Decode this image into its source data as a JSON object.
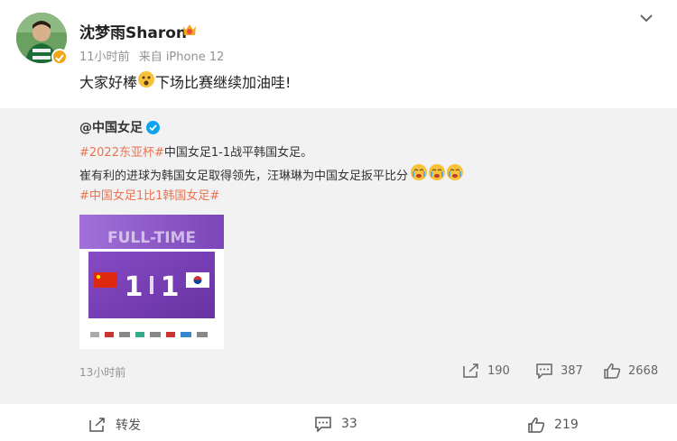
{
  "header": {
    "username": "沈梦雨Sharon",
    "time": "11小时前",
    "source": "来自 iPhone 12",
    "post_text_1": "大家好棒",
    "post_text_2": "下场比赛继续加油哇!",
    "avatar_icon": "avatar-photo",
    "badge_icon": "verified-gold-badge",
    "crown_icon": "crying-face-emoji"
  },
  "repost": {
    "author": "@中国女足",
    "tag1": "#2022东亚杯#",
    "line1_text": "中国女足1-1战平韩国女足。",
    "line2_text": "崔有利的进球为韩国女足取得领先，汪琳琳为中国女足扳平比分",
    "tag2": "#中国女足1比1韩国女足#",
    "image": {
      "banner": "FULL-TIME",
      "score_left": "1",
      "score_right": "1",
      "left_flag": "china-flag",
      "right_flag": "korea-flag"
    },
    "time": "13小时前",
    "shares": "190",
    "comments": "387",
    "likes": "2668"
  },
  "actions": {
    "forward": "转发",
    "comments": "33",
    "likes": "219"
  },
  "colors": {
    "accent": "#eb7350",
    "repost_bg": "#f2f2f2",
    "verified_blue": "#0ea5f0",
    "verified_gold": "#f3a417",
    "purple": "#7a3fb8"
  }
}
